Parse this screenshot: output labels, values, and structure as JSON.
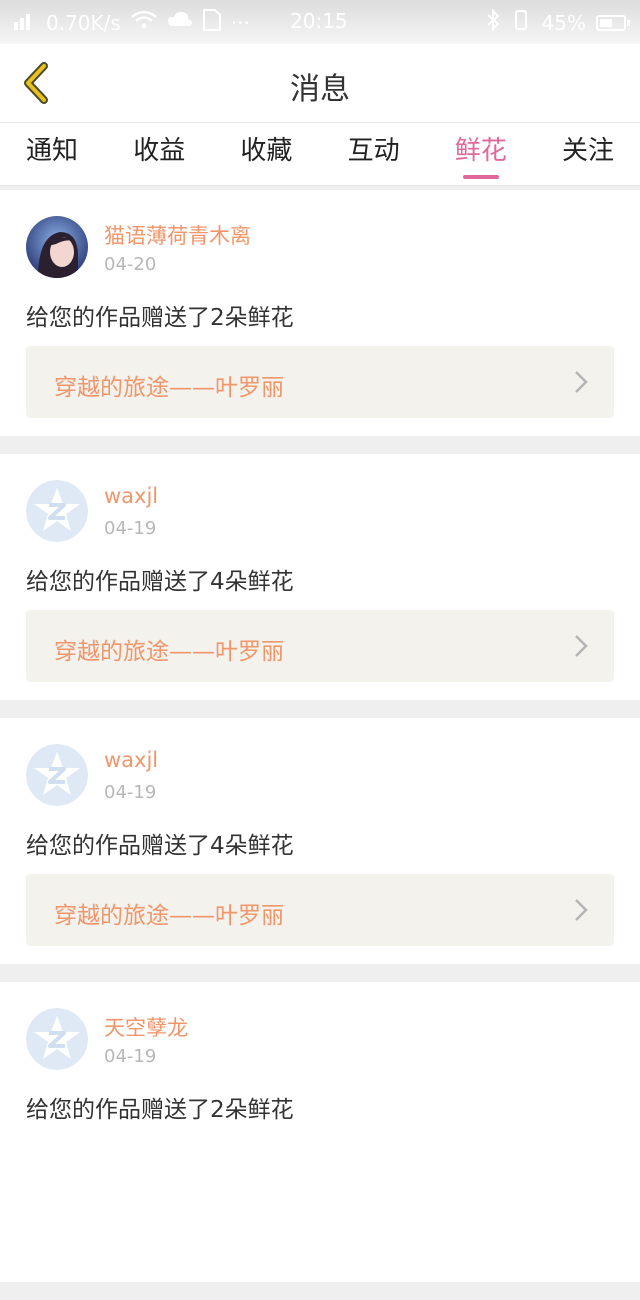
{
  "status_bar": {
    "network_speed": "0.70K/s",
    "time": "20:15",
    "battery": "45%"
  },
  "header": {
    "title": "消息",
    "back_icon": "back-chevron-icon"
  },
  "tabs": [
    {
      "label": "通知",
      "active": false
    },
    {
      "label": "收益",
      "active": false
    },
    {
      "label": "收藏",
      "active": false
    },
    {
      "label": "互动",
      "active": false
    },
    {
      "label": "鲜花",
      "active": true
    },
    {
      "label": "关注",
      "active": false
    }
  ],
  "messages": [
    {
      "username": "猫语薄荷青木离",
      "date": "04-20",
      "text": "给您的作品赠送了2朵鲜花",
      "work_title": "穿越的旅途——叶罗丽",
      "avatar": "photo-avatar"
    },
    {
      "username": "waxjl",
      "date": "04-19",
      "text": "给您的作品赠送了4朵鲜花",
      "work_title": "穿越的旅途——叶罗丽",
      "avatar": "default-avatar"
    },
    {
      "username": "waxjl",
      "date": "04-19",
      "text": "给您的作品赠送了4朵鲜花",
      "work_title": "穿越的旅途——叶罗丽",
      "avatar": "default-avatar"
    },
    {
      "username": "天空孽龙",
      "date": "04-19",
      "text": "给您的作品赠送了2朵鲜花",
      "work_title": "",
      "avatar": "default-avatar"
    }
  ],
  "colors": {
    "accent_pink": "#e0689b",
    "username_orange": "#f0966b",
    "back_icon_yellow": "#e8c21a"
  }
}
